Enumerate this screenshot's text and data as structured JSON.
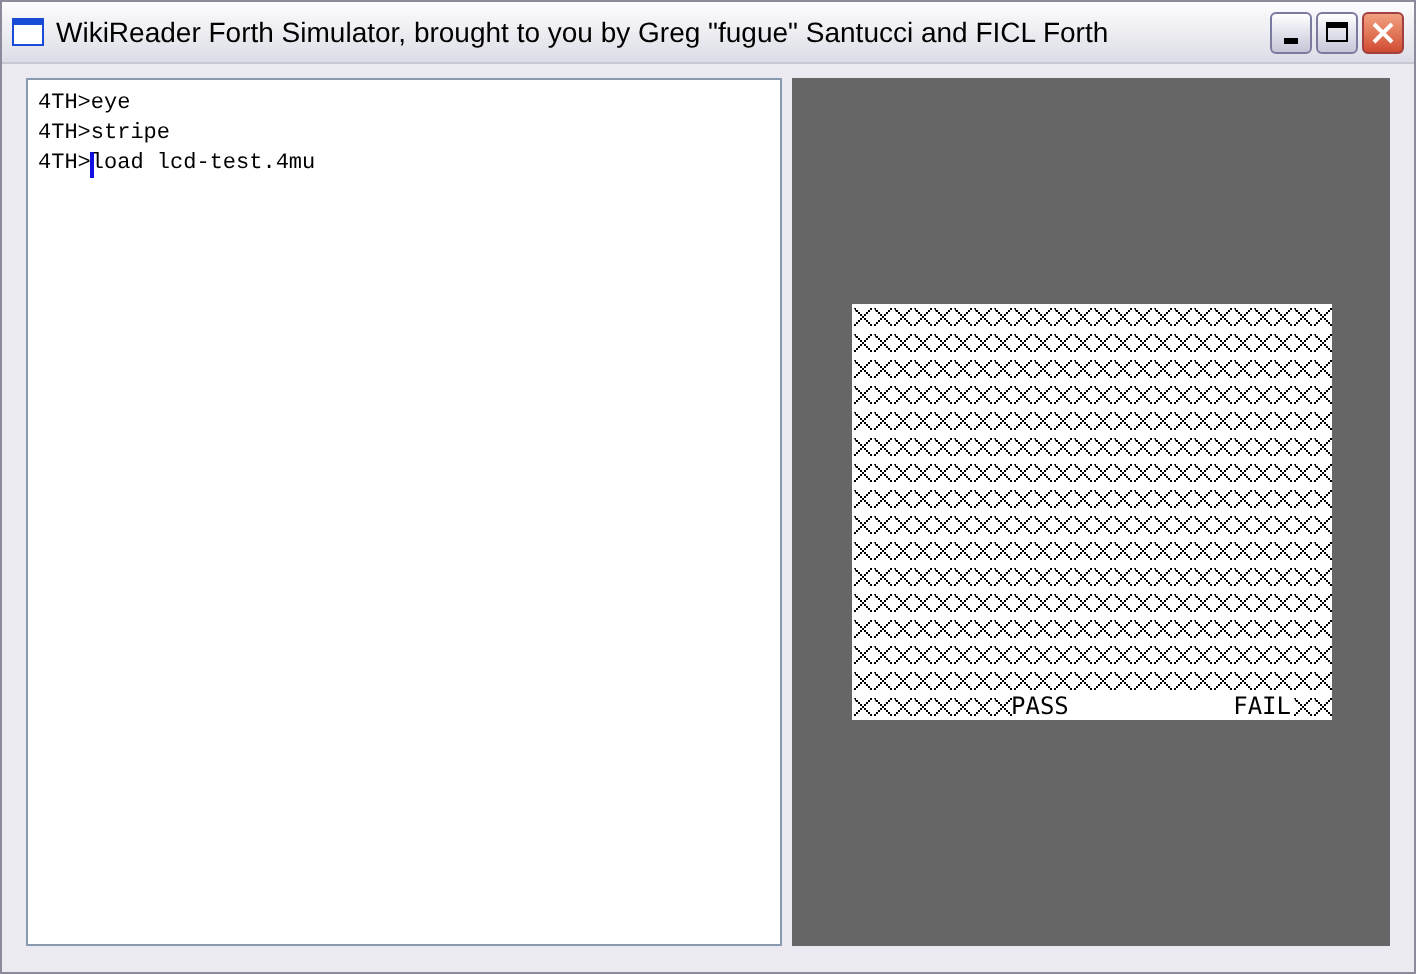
{
  "window": {
    "title": "WikiReader Forth Simulator, brought to you by Greg \"fugue\" Santucci and FICL Forth"
  },
  "console": {
    "lines": [
      {
        "prompt": "4TH>",
        "command": "eye",
        "cursor": false
      },
      {
        "prompt": "4TH>",
        "command": "stripe",
        "cursor": false
      },
      {
        "prompt": "4TH>",
        "command": "load lcd-test.4mu",
        "cursor": true
      }
    ]
  },
  "lcd": {
    "pass_label": "PASS",
    "fail_label": "FAIL"
  }
}
